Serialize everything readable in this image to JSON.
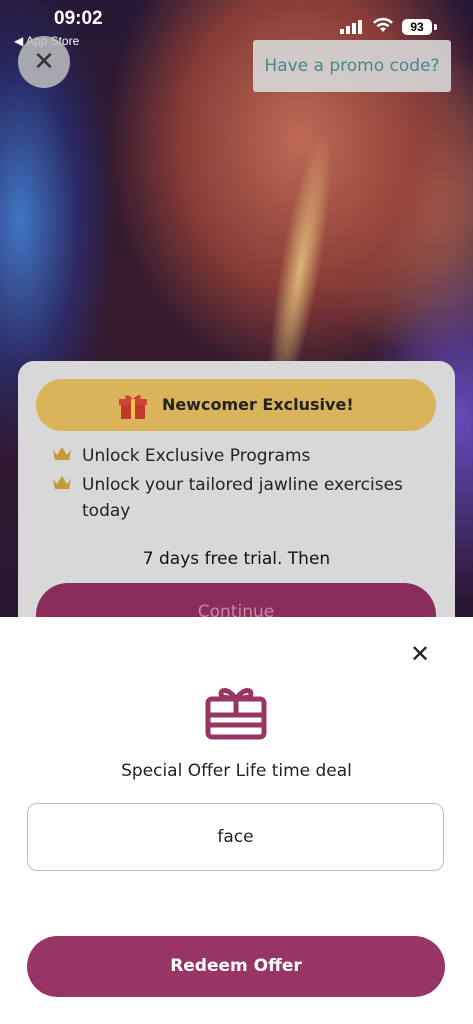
{
  "status_bar": {
    "time": "09:02",
    "back_app": "◀ App Store",
    "battery": "93"
  },
  "header": {
    "close_glyph": "✕",
    "promo_label": "Have a promo code?"
  },
  "card": {
    "exclusive_label": "Newcomer Exclusive!",
    "features": [
      "Unlock Exclusive Programs",
      "Unlock your tailored jawline exercises today"
    ],
    "trial_text": "7 days free trial. Then",
    "continue_label": "Continue"
  },
  "sheet": {
    "close_glyph": "✕",
    "title": "Special Offer Life time deal",
    "code_value": "face",
    "redeem_label": "Redeem Offer"
  },
  "colors": {
    "brand": "#973665",
    "gold": "#d9b45a",
    "promo_text": "#3f8a8a"
  },
  "icons": {
    "gift": "gift-icon",
    "crown": "crown-icon",
    "close": "close-icon",
    "signal": "signal-icon",
    "wifi": "wifi-icon",
    "battery": "battery-icon"
  }
}
